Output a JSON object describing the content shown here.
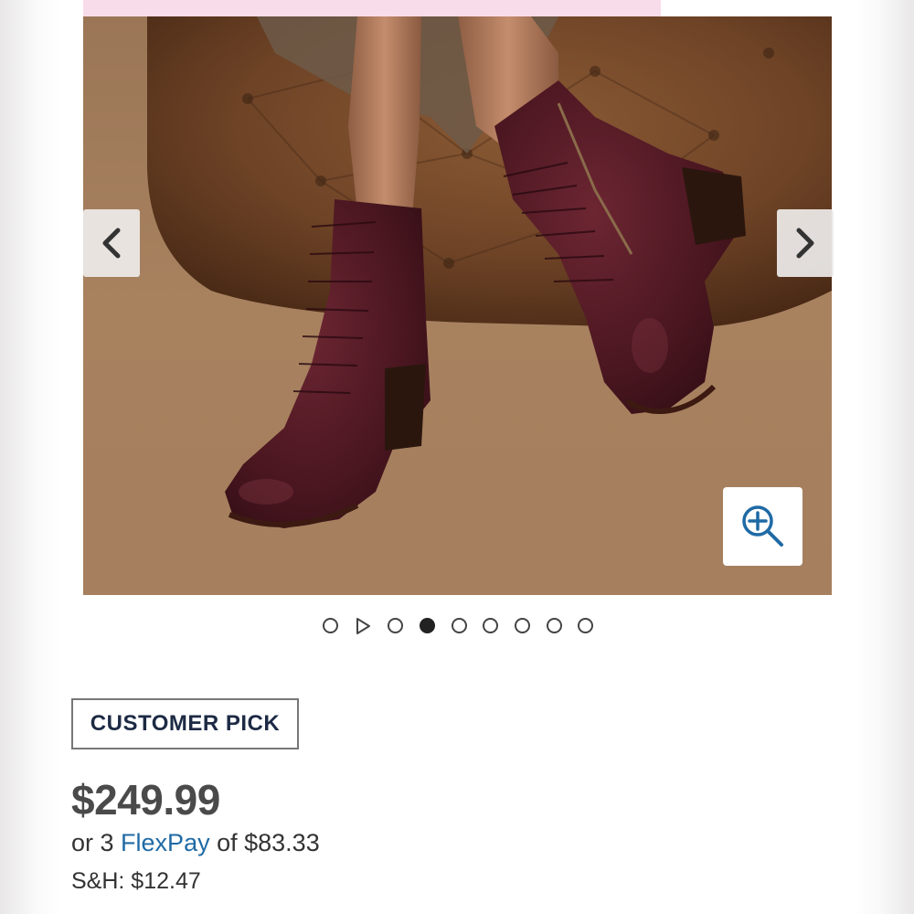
{
  "product": {
    "image_alt": "Burgundy leather lace-up heeled ankle boots",
    "price": "$249.99",
    "flexpay": {
      "prefix": "or 3",
      "link_label": "FlexPay",
      "suffix": "of $83.33"
    },
    "shipping": "S&H: $12.47",
    "badge": "CUSTOMER PICK"
  },
  "carousel": {
    "total_slides": 9,
    "active_index": 3,
    "has_video_slide_index": 1,
    "prev_icon": "chevron-left-icon",
    "next_icon": "chevron-right-icon",
    "zoom_icon": "zoom-in-icon"
  },
  "colors": {
    "badge_text": "#1d2a44",
    "link": "#1f6aa5",
    "zoom_icon": "#1f6aa5",
    "promo_strip": "#f8dcea"
  }
}
